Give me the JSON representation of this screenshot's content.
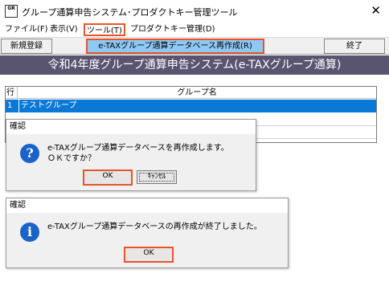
{
  "window": {
    "icon_text": "GR",
    "title": "グループ通算申告システム･プロダクトキー管理ツール",
    "close_glyph": "✕"
  },
  "menu": {
    "items": [
      {
        "label": "ファイル(F)"
      },
      {
        "label": "表示(V)"
      },
      {
        "label": "ツール(T)"
      },
      {
        "label": "プロダクトキー管理(D)"
      }
    ]
  },
  "toolbar": {
    "new_label": "新規登録",
    "rebuild_label": "e-TAXグループ通算データベース再作成(R)",
    "exit_label": "終了"
  },
  "banner": {
    "text": "令和4年度グループ通算申告システム(e-TAXグループ通算)"
  },
  "grid": {
    "columns": [
      "行",
      "グループ名"
    ],
    "rows": [
      {
        "num": "1",
        "name": "テストグループ"
      }
    ]
  },
  "dialog_confirm": {
    "title": "確認",
    "icon": "question-icon",
    "icon_glyph": "?",
    "message_line1": "e-TAXグループ通算データベースを再作成します。",
    "message_line2": "ＯＫですか？",
    "ok_label": "OK",
    "cancel_label": "ｷｬﾝｾﾙ"
  },
  "dialog_done": {
    "title": "確認",
    "icon": "info-icon",
    "icon_glyph": "i",
    "message": "e-TAXグループ通算データベースの再作成が終了しました。",
    "ok_label": "OK"
  },
  "colors": {
    "banner_bg": "#5b5470",
    "selection": "#0a78d7",
    "highlight_border": "#e8542a",
    "active_button": "#8ec9f6"
  }
}
